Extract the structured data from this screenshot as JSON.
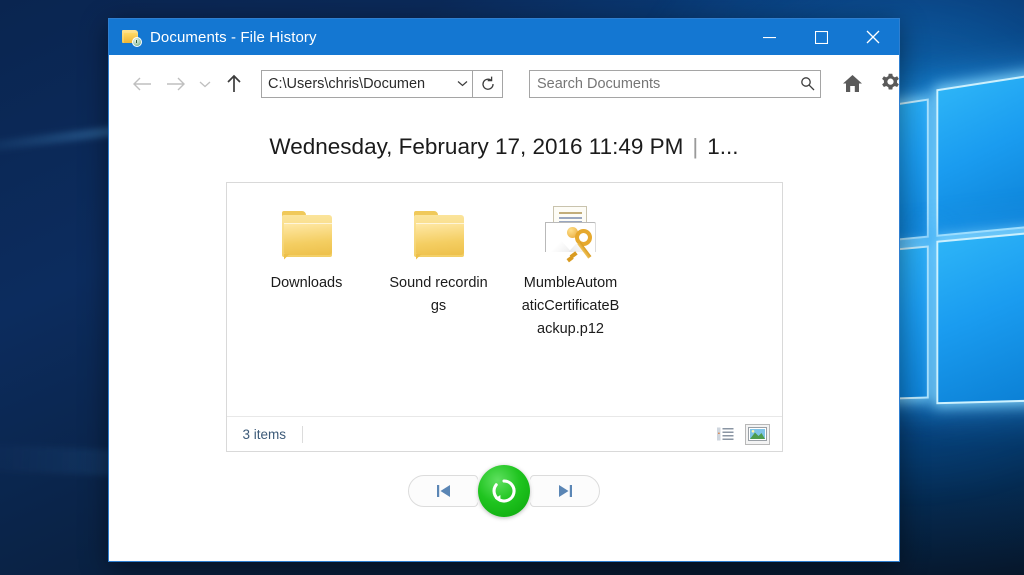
{
  "window": {
    "title": "Documents - File History",
    "app_icon": "folder-history-icon",
    "controls": {
      "minimize": "Minimize",
      "maximize": "Maximize",
      "close": "Close"
    }
  },
  "toolbar": {
    "back_label": "Back",
    "forward_label": "Forward",
    "recent_label": "Recent locations",
    "up_label": "Up",
    "address_value": "C:\\Users\\chris\\Documen",
    "address_dropdown": "chevron-down-icon",
    "refresh_label": "Refresh",
    "search_placeholder": "Search Documents",
    "search_value": "",
    "search_icon": "search-icon",
    "home_label": "Home",
    "settings_label": "Settings"
  },
  "main": {
    "date_heading": "Wednesday, February 17, 2016 11:49 PM",
    "heading_separator": "|",
    "version_counter": "1...",
    "items": [
      {
        "name": "Downloads",
        "type": "folder",
        "icon": "folder-icon"
      },
      {
        "name": "Sound recordings",
        "type": "folder",
        "icon": "folder-icon"
      },
      {
        "name": "MumbleAutomaticCertificateBackup.p12",
        "type": "file",
        "icon": "certificate-key-icon"
      }
    ]
  },
  "statusbar": {
    "item_count": "3 items",
    "view_details_label": "Details view",
    "view_thumbnails_label": "Large icons view",
    "active_view": "thumbnails"
  },
  "restore_controls": {
    "previous_label": "Previous version",
    "next_label": "Next version",
    "restore_label": "Restore to original location"
  },
  "colors": {
    "titlebar": "#1477d2",
    "restore_green": "#15c415",
    "window_border": "#2f7fd0",
    "folder_yellow": "#f4ce62"
  }
}
